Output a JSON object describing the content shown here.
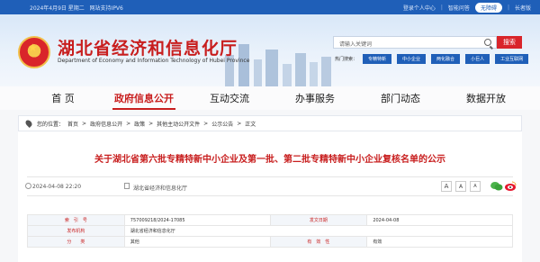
{
  "topbar": {
    "date_text": "2024年4月9日  星期二",
    "ipv6_text": "网站支持IPV6",
    "login": "登录个人中心",
    "smart_qa": "智能问答",
    "accessibility": "无障碍",
    "elder": "长者版"
  },
  "header": {
    "title": "湖北省经济和信息化厅",
    "subtitle": "Department of Economy and Information Technology of Hubei Province",
    "search_placeholder": "请输入关键词",
    "search_button": "搜索",
    "quick_label": "热门搜索：",
    "quick_items": [
      "专精特新",
      "中小企业",
      "两化融合",
      "小巨人",
      "工业互联网"
    ]
  },
  "nav": {
    "items": [
      "首 页",
      "政府信息公开",
      "互动交流",
      "办事服务",
      "部门动态",
      "数据开放"
    ]
  },
  "breadcrumb": {
    "label": "您的位置：",
    "items": [
      "首页",
      "政府信息公开",
      "政策",
      "其他主动公开文件",
      "公示公告",
      "正文"
    ]
  },
  "article": {
    "title": "关于湖北省第六批专精特新中小企业及第一批、第二批专精特新中小企业复核名单的公示",
    "date": "2024-04-08 22:20",
    "org": "湖北省经济和信息化厅",
    "font_labels": [
      "A",
      "A",
      "A"
    ]
  },
  "info_table": {
    "rows": [
      {
        "k1": "索　引　号",
        "v1": "757009218/2024-17085",
        "k2": "发文日期",
        "v2": "2024-04-08"
      },
      {
        "k1": "发布机构",
        "v1": "湖北省经济和信息化厅",
        "k2": "",
        "v2": ""
      },
      {
        "k1": "分　　类",
        "v1": "其他",
        "k2": "有　效　性",
        "v2": "有效"
      }
    ]
  },
  "colors": {
    "brand_red": "#c81e1e",
    "top_blue": "#1f5fb8"
  }
}
